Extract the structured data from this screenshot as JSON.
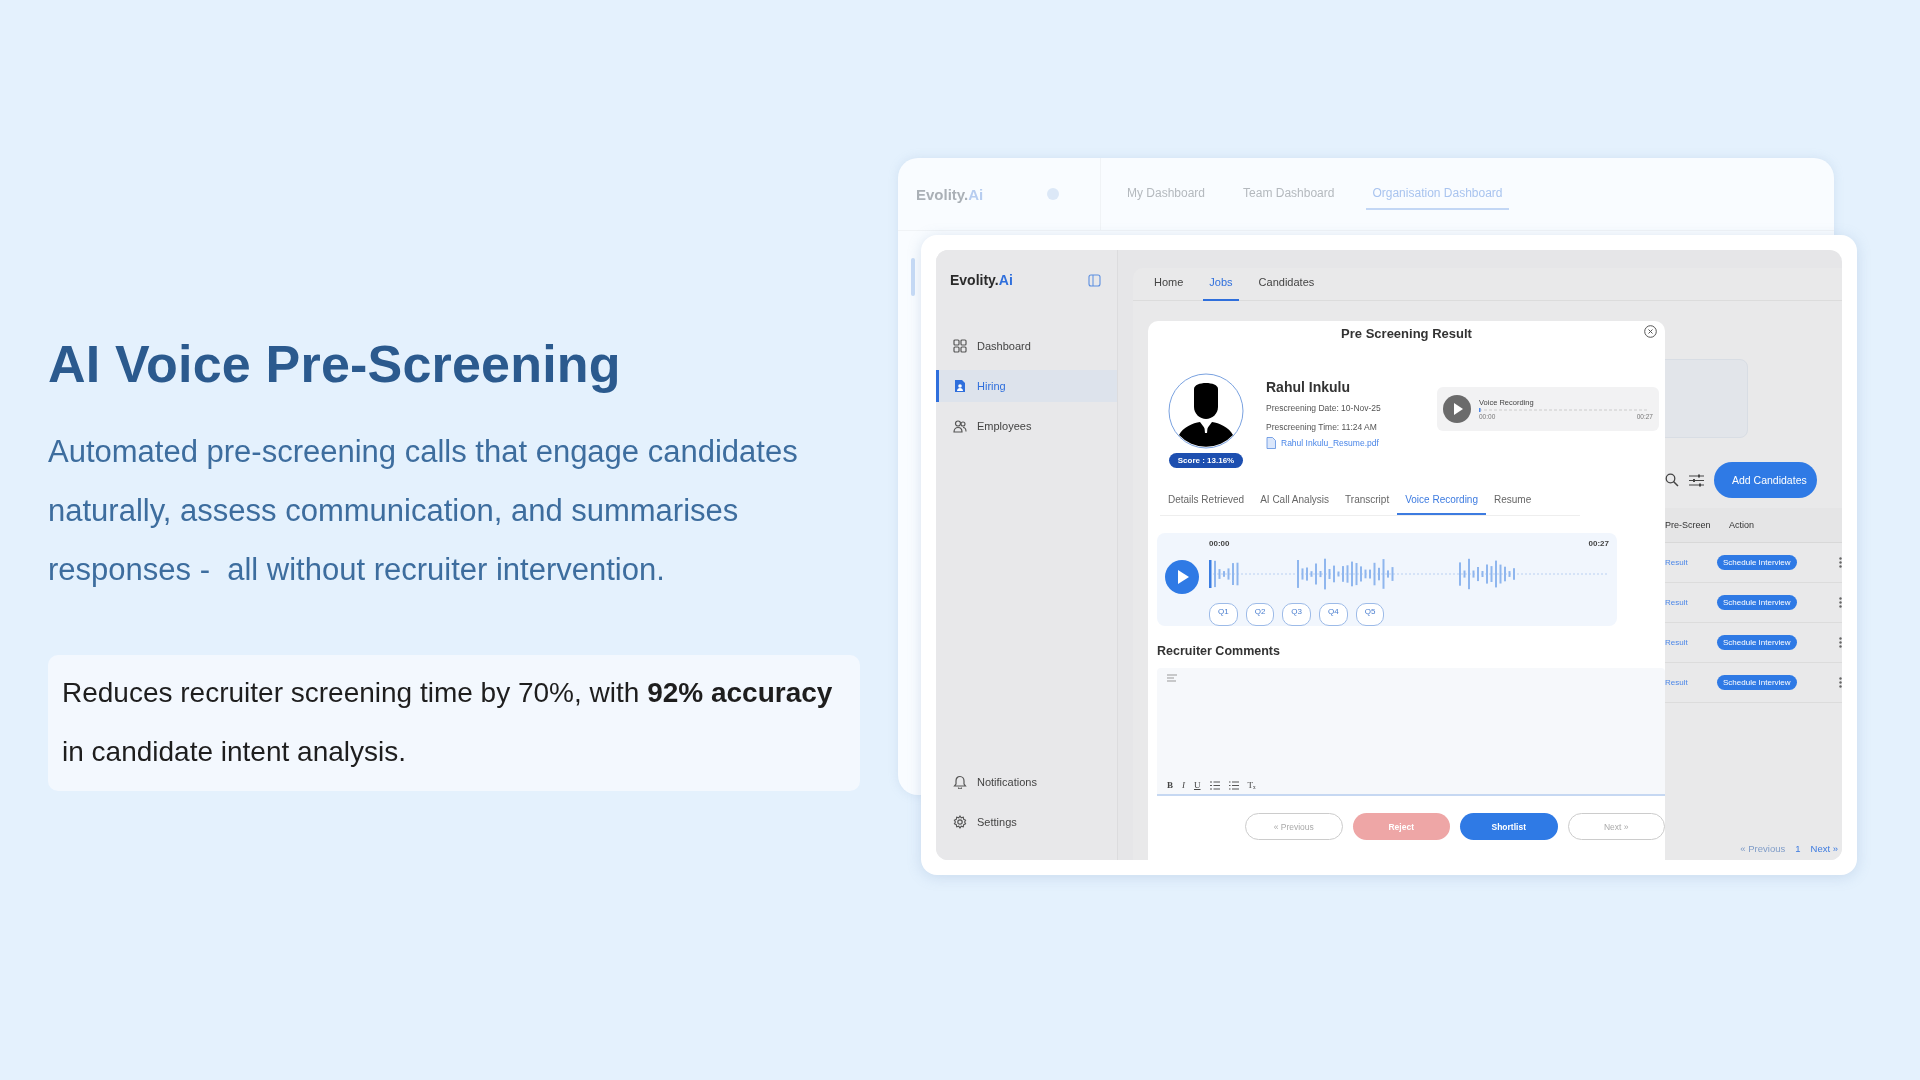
{
  "hero": {
    "title": "AI Voice Pre-Screening",
    "description": "Automated pre-screening calls that engage candidates naturally, assess communication, and summarises responses -  all without recruiter intervention.",
    "highlight": "Reduces recruiter screening time by 70%, with **92% accuracy** in candidate intent analysis."
  },
  "back_window": {
    "logo": {
      "text": "Evolity.",
      "accent": "Ai"
    },
    "tabs": [
      {
        "label": "My Dashboard",
        "selected": false
      },
      {
        "label": "Team Dashboard",
        "selected": false
      },
      {
        "label": "Organisation Dashboard",
        "selected": true
      }
    ]
  },
  "app": {
    "logo": {
      "text": "Evolity.",
      "accent": "Ai"
    },
    "sidebar": {
      "items": [
        {
          "label": "Dashboard",
          "selected": false
        },
        {
          "label": "Hiring",
          "selected": true
        },
        {
          "label": "Employees",
          "selected": false
        }
      ],
      "bottom_items": [
        {
          "label": "Notifications",
          "selected": false
        },
        {
          "label": "Settings",
          "selected": false
        }
      ]
    },
    "tabs": [
      {
        "label": "Home",
        "selected": false
      },
      {
        "label": "Jobs",
        "selected": true
      },
      {
        "label": "Candidates",
        "selected": false
      }
    ],
    "modal": {
      "title": "Pre Screening Result",
      "candidate": {
        "name": "Rahul Inkulu",
        "score": "Score : 13.16%",
        "date": "Prescreening Date: 10-Nov-25",
        "time": "Prescreening Time: 11:24 AM",
        "resume": "Rahul Inkulu_Resume.pdf"
      },
      "mini_player": {
        "label": "Voice Recording",
        "start": "00:00",
        "end": "00:27"
      },
      "tabs": [
        {
          "label": "Details Retrieved",
          "selected": false
        },
        {
          "label": "AI Call Analysis",
          "selected": false
        },
        {
          "label": "Transcript",
          "selected": false
        },
        {
          "label": "Voice Recording",
          "selected": true
        },
        {
          "label": "Resume",
          "selected": false
        }
      ],
      "player": {
        "start": "00:00",
        "end": "00:27",
        "questions": [
          "Q1",
          "Q2",
          "Q3",
          "Q4",
          "Q5"
        ]
      },
      "comments": {
        "title": "Recruiter Comments",
        "toolbar": [
          {
            "kind": "text",
            "label": "B"
          },
          {
            "kind": "text",
            "label": "I"
          },
          {
            "kind": "text",
            "label": "U"
          },
          {
            "kind": "ordered-list"
          },
          {
            "kind": "bullet-list"
          },
          {
            "kind": "text",
            "label": "Tₓ"
          }
        ]
      },
      "buttons": [
        {
          "label": "« Previous",
          "kind": "outline"
        },
        {
          "label": "Reject",
          "kind": "danger"
        },
        {
          "label": "Shortlist",
          "kind": "primary"
        },
        {
          "label": "Next »",
          "kind": "outline"
        }
      ]
    },
    "table": {
      "button": "Add Candidates",
      "columns": [
        "Pre-Screen",
        "Action"
      ],
      "rows": [
        {
          "result": "Result",
          "action": "Schedule Interview"
        },
        {
          "result": "Result",
          "action": "Schedule Interview"
        },
        {
          "result": "Result",
          "action": "Schedule Interview"
        },
        {
          "result": "Result",
          "action": "Schedule Interview"
        }
      ],
      "pagination": {
        "previous": "« Previous",
        "page": "1",
        "next": "Next »"
      }
    }
  }
}
